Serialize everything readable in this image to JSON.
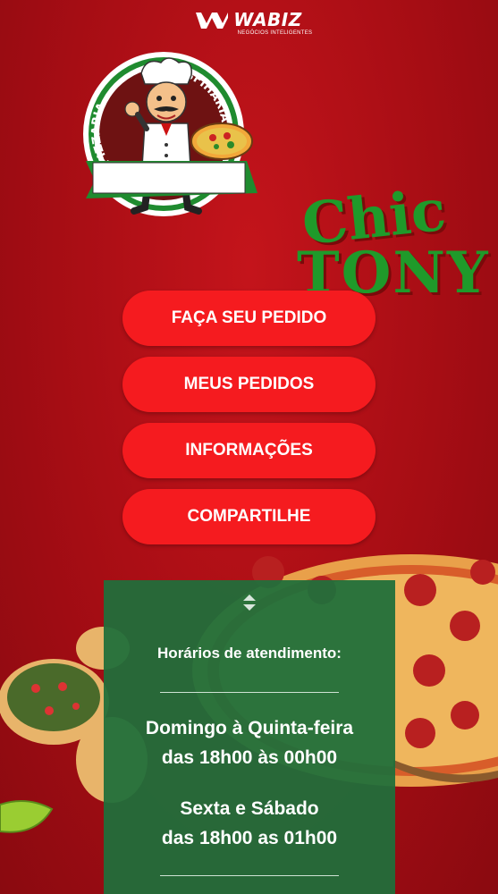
{
  "brand": {
    "name": "WABIZ",
    "tagline": "NEGÓCIOS INTELIGENTES"
  },
  "logo": {
    "arc_left": "PIZZARIA",
    "arc_right": "ESFIHARIA",
    "word1": "Chic",
    "word2": "TONY"
  },
  "menu": [
    {
      "label": "FAÇA SEU PEDIDO"
    },
    {
      "label": "MEUS PEDIDOS"
    },
    {
      "label": "INFORMAÇÕES"
    },
    {
      "label": "COMPARTILHE"
    }
  ],
  "hours": {
    "title": "Horários de atendimento:",
    "schedule": [
      {
        "days": "Domingo à Quinta-feira",
        "time": "das 18h00 às 00h00"
      },
      {
        "days": "Sexta e Sábado",
        "time": "das 18h00 as 01h00"
      }
    ]
  },
  "colors": {
    "background": "#a60d14",
    "button": "#f51b1f",
    "panel": "#206e3a",
    "logo_green": "#1f9a2a"
  }
}
